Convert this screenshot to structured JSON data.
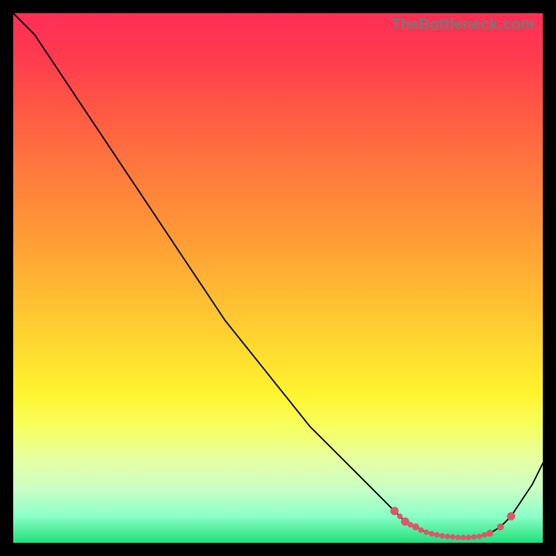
{
  "watermark": "TheBottleneck.com",
  "colors": {
    "curve": "#000000",
    "dot": "#d85a6a",
    "gradient_top": "#ff2f55",
    "gradient_bottom": "#20e07a",
    "frame": "#000000"
  },
  "chart_data": {
    "type": "line",
    "title": "",
    "xlabel": "",
    "ylabel": "",
    "xlim": [
      0,
      100
    ],
    "ylim": [
      0,
      100
    ],
    "grid": false,
    "legend": false,
    "x": [
      0,
      4,
      8,
      12,
      16,
      20,
      24,
      28,
      32,
      36,
      40,
      44,
      48,
      52,
      56,
      60,
      64,
      68,
      72,
      74,
      76,
      78,
      80,
      82,
      84,
      86,
      88,
      90,
      92,
      94,
      96,
      98,
      100
    ],
    "y": [
      100,
      96,
      90,
      84,
      78,
      72,
      66,
      60,
      54,
      48,
      42,
      37,
      32,
      27,
      22,
      18,
      14,
      10,
      6,
      4,
      3,
      2,
      1.5,
      1.2,
      1,
      1,
      1.2,
      1.8,
      3,
      5,
      8,
      11,
      15
    ],
    "highlight_points": {
      "x": [
        72,
        73,
        74,
        75,
        76,
        77,
        78,
        79,
        80,
        81,
        82,
        83,
        84,
        85,
        86,
        87,
        88,
        89,
        90,
        92,
        94
      ],
      "y": [
        6,
        5,
        4,
        3.4,
        3,
        2.4,
        2,
        1.7,
        1.5,
        1.3,
        1.2,
        1.1,
        1,
        1,
        1,
        1.1,
        1.2,
        1.5,
        1.8,
        3,
        5
      ],
      "r": [
        6,
        4,
        6,
        4,
        5,
        4,
        4,
        4,
        4,
        4,
        4,
        4,
        4,
        4,
        4,
        4,
        4,
        4,
        5,
        5,
        6
      ]
    }
  }
}
